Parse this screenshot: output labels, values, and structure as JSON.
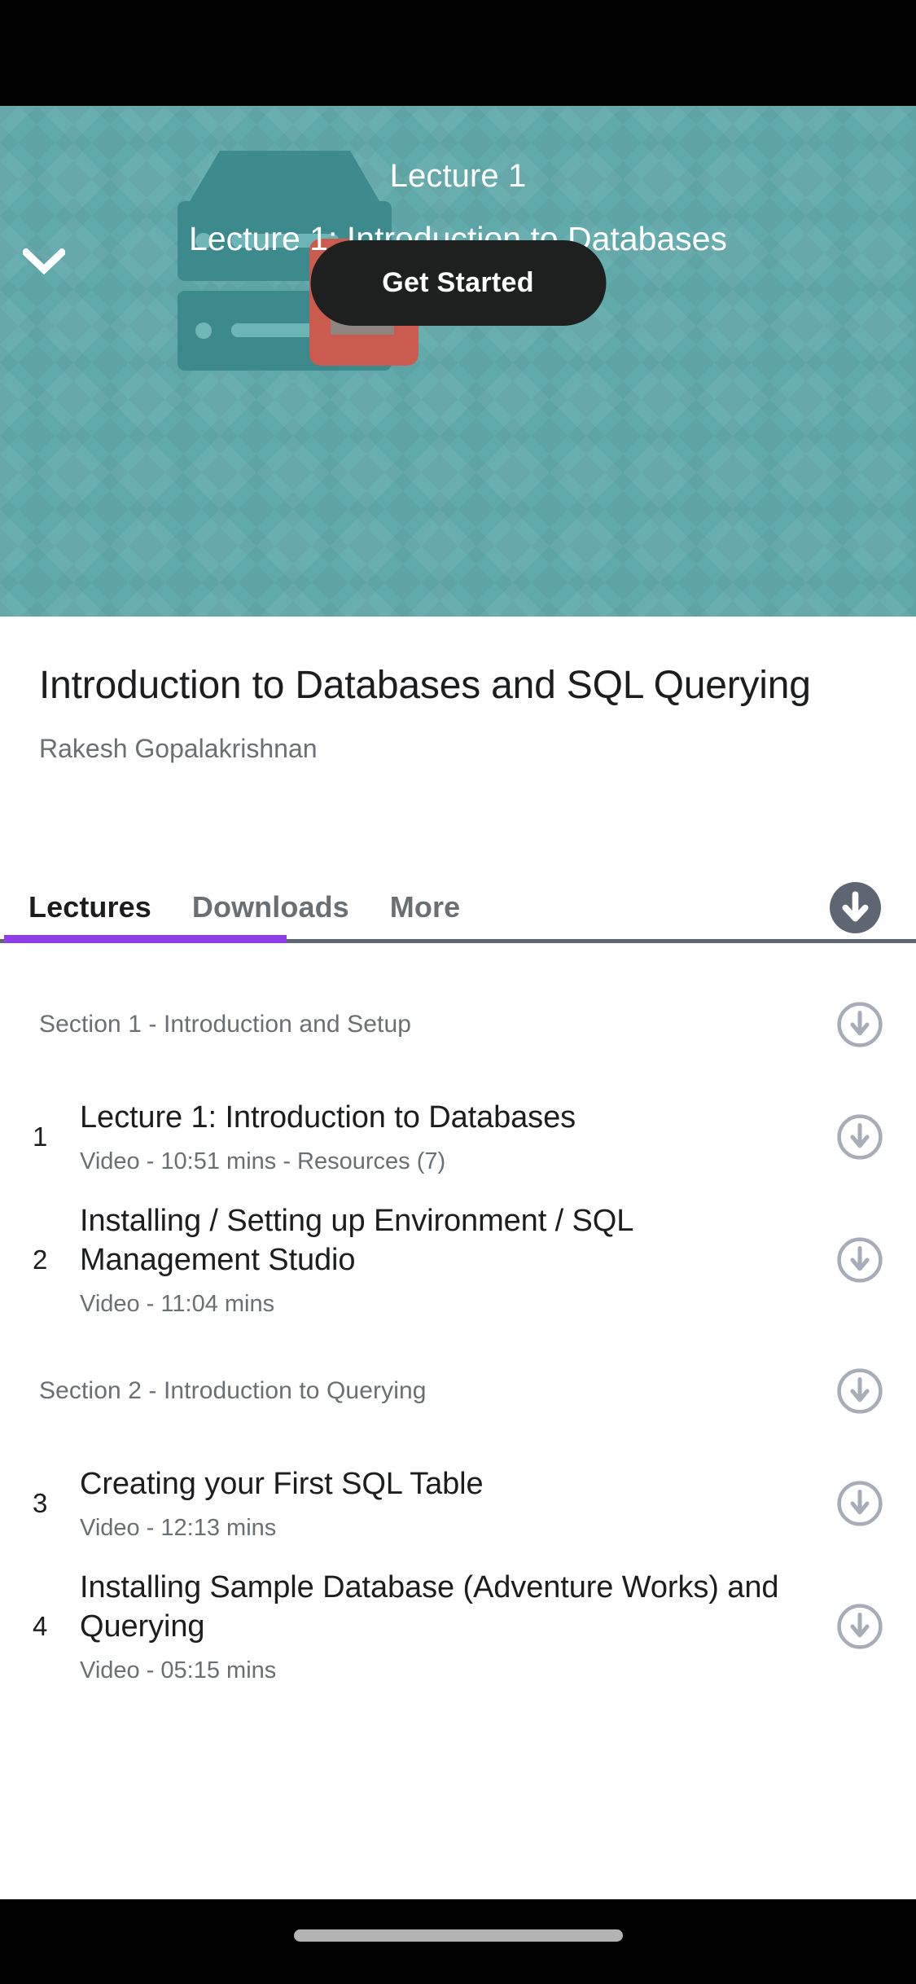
{
  "hero": {
    "collapse_icon": "chevron-down-icon",
    "lecture_number": "Lecture 1",
    "lecture_title": "Lecture 1: Introduction to Databases",
    "cta_label": "Get Started",
    "background_color": "#61aaab",
    "cta_color": "#1e1f1f"
  },
  "course": {
    "title": "Introduction to Databases and SQL Querying",
    "author": "Rakesh Gopalakrishnan"
  },
  "tabs": {
    "items": [
      {
        "label": "Lectures",
        "active": true
      },
      {
        "label": "Downloads",
        "active": false
      },
      {
        "label": "More",
        "active": false
      }
    ],
    "active_indicator_color": "#8e3fe8",
    "download_all_icon": "download-circle-filled-icon"
  },
  "curriculum": [
    {
      "type": "section",
      "label": "Section 1 - Introduction and Setup",
      "download_icon": "download-circle-icon"
    },
    {
      "type": "lecture",
      "number": "1",
      "title": "Lecture 1: Introduction to Databases",
      "meta": "Video - 10:51 mins - Resources (7)",
      "download_icon": "download-circle-icon"
    },
    {
      "type": "lecture",
      "number": "2",
      "title": "Installing / Setting up Environment / SQL Management Studio",
      "meta": "Video - 11:04 mins",
      "download_icon": "download-circle-icon"
    },
    {
      "type": "section",
      "label": "Section 2 - Introduction to Querying",
      "download_icon": "download-circle-icon"
    },
    {
      "type": "lecture",
      "number": "3",
      "title": "Creating your First SQL Table",
      "meta": "Video - 12:13 mins",
      "download_icon": "download-circle-icon"
    },
    {
      "type": "lecture",
      "number": "4",
      "title": "Installing Sample Database (Adventure Works) and Querying",
      "meta": "Video - 05:15 mins",
      "download_icon": "download-circle-icon"
    }
  ],
  "system": {
    "home_indicator": "home-indicator"
  }
}
